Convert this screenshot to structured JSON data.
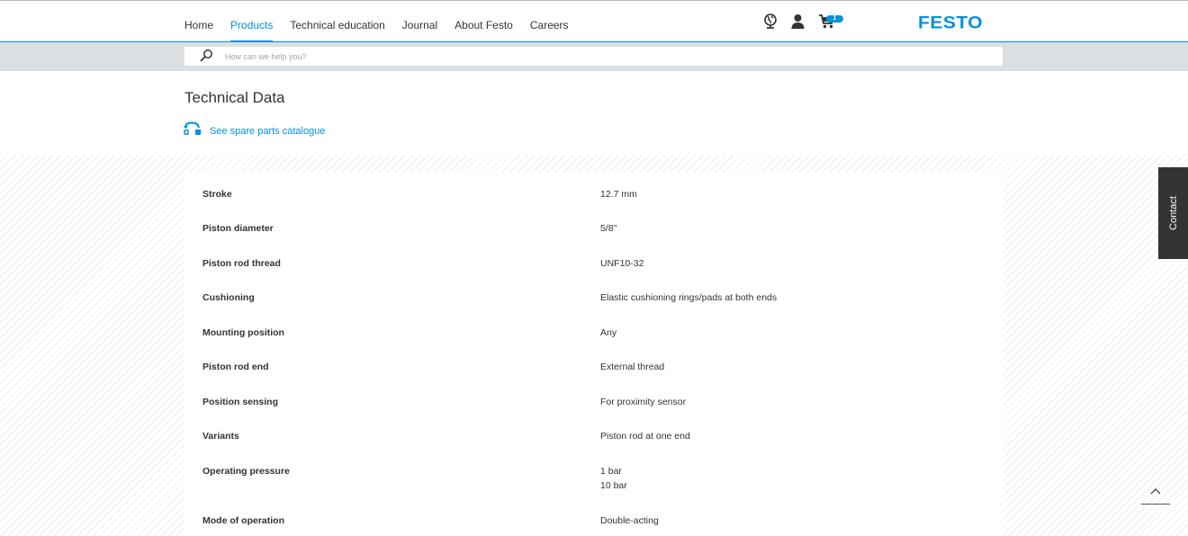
{
  "nav": {
    "items": [
      {
        "label": "Home",
        "active": false
      },
      {
        "label": "Products",
        "active": true
      },
      {
        "label": "Technical education",
        "active": false
      },
      {
        "label": "Journal",
        "active": false
      },
      {
        "label": "About Festo",
        "active": false
      },
      {
        "label": "Careers",
        "active": false
      }
    ],
    "icons": [
      "globe-icon",
      "user-icon",
      "cart-icon"
    ],
    "cart_count": "1",
    "logo": "FESTO"
  },
  "search": {
    "placeholder": "How can we help you?"
  },
  "section": {
    "title": "Technical Data",
    "spare_link": "See spare parts catalogue"
  },
  "tech_data": [
    {
      "label": "Stroke",
      "value": "12.7 mm"
    },
    {
      "label": "Piston diameter",
      "value": "5/8\""
    },
    {
      "label": "Piston rod thread",
      "value": "UNF10-32"
    },
    {
      "label": "Cushioning",
      "value": "Elastic cushioning rings/pads at both ends"
    },
    {
      "label": "Mounting position",
      "value": "Any"
    },
    {
      "label": "Piston rod end",
      "value": "External thread"
    },
    {
      "label": "Position sensing",
      "value": "For proximity sensor"
    },
    {
      "label": "Variants",
      "value": "Piston rod at one end"
    },
    {
      "label": "Operating pressure",
      "value": "1 bar",
      "value2": "10 bar"
    },
    {
      "label": "Mode of operation",
      "value": "Double-acting"
    }
  ],
  "side": {
    "contact_label": "Contact"
  },
  "colors": {
    "brand": "#0091dc",
    "text": "#333333",
    "search_band": "#dcdfe2",
    "contact_bg": "#333333"
  }
}
